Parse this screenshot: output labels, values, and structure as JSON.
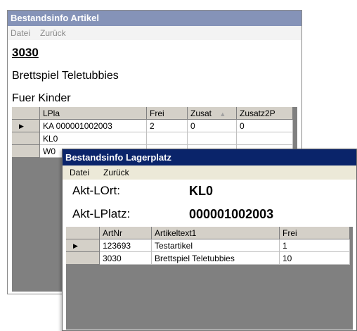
{
  "colors": {
    "article_titlebar": "#8593b8",
    "lagerplatz_titlebar": "#0a246a",
    "grid_background": "#808080",
    "header_background": "#d4d0c8"
  },
  "article_window": {
    "title": "Bestandsinfo Artikel",
    "menu": [
      "Datei",
      "Zurück"
    ],
    "article_number": "3030",
    "article_name": "Brettspiel Teletubbies",
    "article_note": "Fuer Kinder",
    "grid": {
      "columns": [
        "LPla",
        "Frei",
        "Zusat",
        "Zusatz2P"
      ],
      "rows": [
        {
          "indicator": "▶",
          "cells": [
            "KA 000001002003",
            "2",
            "0",
            "0"
          ]
        },
        {
          "indicator": "",
          "cells": [
            "KL0",
            "",
            "",
            ""
          ]
        },
        {
          "indicator": "",
          "cells": [
            "W0",
            "",
            "",
            ""
          ]
        }
      ]
    }
  },
  "lagerplatz_window": {
    "title": "Bestandsinfo Lagerplatz",
    "menu": [
      "Datei",
      "Zurück"
    ],
    "lort_label": "Akt-LOrt:",
    "lort_value": "KL0",
    "lplatz_label": "Akt-LPlatz:",
    "lplatz_value": "000001002003",
    "grid": {
      "columns": [
        "ArtNr",
        "Artikeltext1",
        "Frei"
      ],
      "rows": [
        {
          "indicator": "▶",
          "cells": [
            "123693",
            "Testartikel",
            "1"
          ]
        },
        {
          "indicator": "",
          "cells": [
            "3030",
            "Brettspiel Teletubbies",
            "10"
          ]
        }
      ]
    }
  }
}
